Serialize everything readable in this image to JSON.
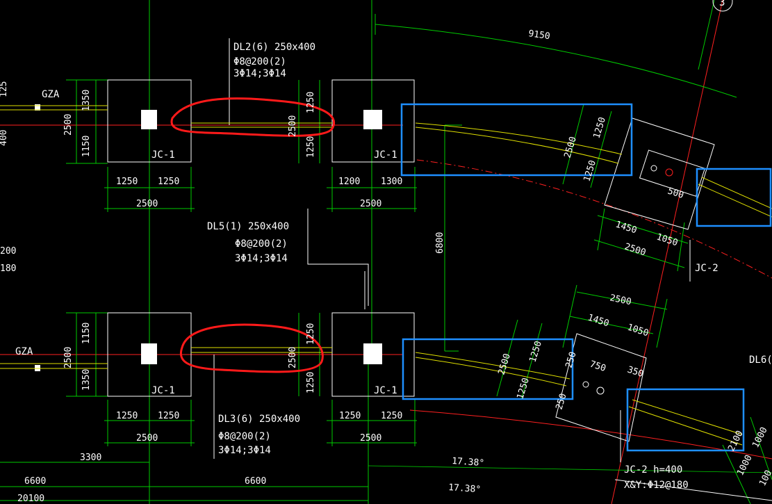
{
  "colors": {
    "background": "#000000",
    "dimension_line": "#00cc00",
    "axis_line": "#ff2020",
    "outline": "#ffffff",
    "beam": "#e0e000",
    "red_markup": "#ff1a1a",
    "blue_markup": "#1e8fff"
  },
  "labels": {
    "dl2_title": "DL2(6) 250x400",
    "dl2_stirrup": "Φ8@200(2)",
    "dl2_bars": "3Φ14;3Φ14",
    "dl5_title": "DL5(1) 250x400",
    "dl5_stirrup": "Φ8@200(2)",
    "dl5_bars": "3Φ14;3Φ14",
    "dl3_title": "DL3(6) 250x400",
    "dl3_stirrup": "Φ8@200(2)",
    "dl3_bars": "3Φ14;3Φ14",
    "jc2_h": "JC-2 h=400",
    "jc2_rebar": "X&Y:Φ12@180",
    "jc1": "JC-1",
    "jc2": "JC-2",
    "gza": "GZA",
    "dl6": "DL6(",
    "elev": "17.38°",
    "axis_mark": "3"
  },
  "dimensions": {
    "d9150": "9150",
    "d6800": "6800",
    "d3300": "3300",
    "d6600": "6600",
    "d20100": "20100",
    "d2500": "2500",
    "d1250": "1250",
    "d1200": "1200",
    "d1300": "1300",
    "d1350": "1350",
    "d1150": "1150",
    "d1450": "1450",
    "d1050": "1050",
    "d500": "500",
    "d750": "750",
    "d350": "350",
    "d250": "250",
    "d1000": "1000",
    "d2100": "2100",
    "d100": "100",
    "d125": "125",
    "d400": "400",
    "d200": "200",
    "d180": "180"
  }
}
